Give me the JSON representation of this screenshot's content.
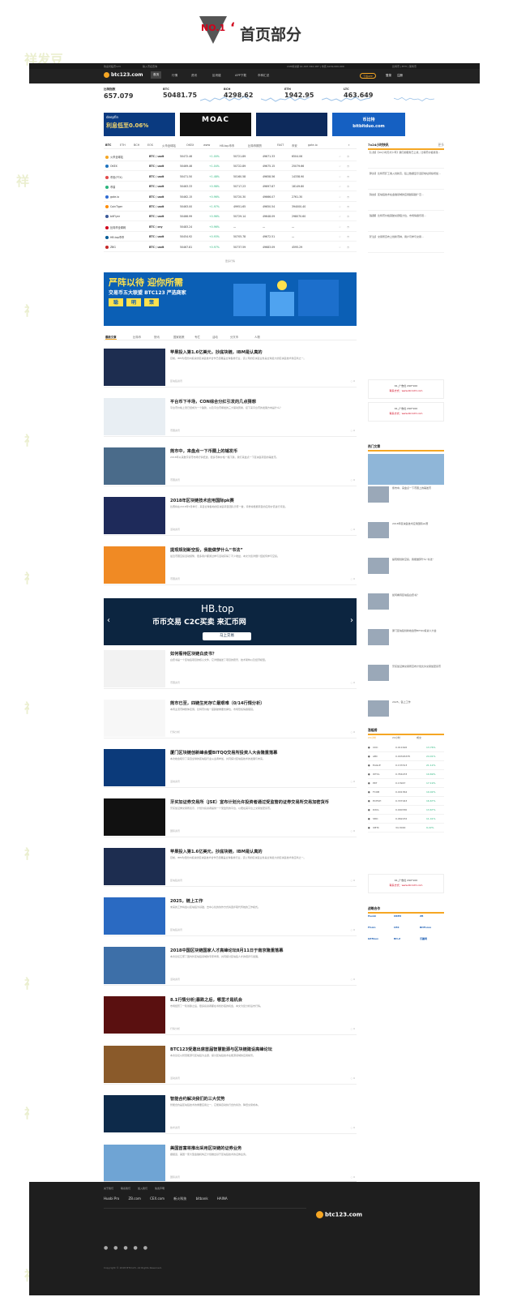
{
  "section_header": {
    "number": "NO.1",
    "title": "首页部分"
  },
  "watermark": "祥发豆",
  "topbar": {
    "left1": "欢迎光临币123",
    "left2": "输入币名查询",
    "mid": "24H成交额 $1,007,342,187 | 市值 $219,000,000",
    "right": "比特币 | ETH | 莱特币"
  },
  "nav": {
    "logo": "btc123.com",
    "items": [
      "首页",
      "行情",
      "资讯",
      "区块链",
      "APP下载",
      "币种汇总"
    ],
    "cta": "下载APP",
    "login": "登录",
    "register": "注册"
  },
  "tickers": [
    {
      "name": "比特指数",
      "price": "657.079"
    },
    {
      "name": "BTC",
      "price": "50481.75"
    },
    {
      "name": "BCH",
      "price": "4298.62"
    },
    {
      "name": "ETH",
      "price": "1942.95"
    },
    {
      "name": "LTC",
      "price": "463.649"
    }
  ],
  "banners": [
    {
      "title": "deepfin",
      "text": "利息低至0.06%"
    },
    {
      "title": "MOAC",
      "text": ""
    },
    {
      "title": "",
      "text": ""
    },
    {
      "title": "币比特",
      "text": "bitbitduo.com"
    }
  ],
  "market_tabs": [
    "BTC",
    "ETH",
    "BCH",
    "EOS",
    "火币全球站",
    "OKEX",
    "www",
    "HB.top币币",
    "比特币期货",
    "FAST",
    "币安",
    "gate.io"
  ],
  "exchanges": [
    {
      "name": "火币全球站",
      "pair": "BTC / usdt",
      "price": "50472.46",
      "change": "+1.00%",
      "high": "50721.89",
      "low": "49671.33",
      "vol": "6504.06"
    },
    {
      "name": "OKEX",
      "pair": "BTC / usdt",
      "price": "50469.46",
      "change": "+1.04%",
      "high": "50722.89",
      "low": "49675.15",
      "vol": "25079.66"
    },
    {
      "name": "币安(FTX)",
      "pair": "BTC / usdt",
      "price": "50471.50",
      "change": "+1.48%",
      "high": "50160.58",
      "low": "49658.56",
      "vol": "14338.90"
    },
    {
      "name": "币易",
      "pair": "BTC / usdt",
      "price": "50463.33",
      "change": "+0.98%",
      "high": "50717.23",
      "low": "49697.87",
      "vol": "18149.80"
    },
    {
      "name": "gate.io",
      "pair": "BTC / usdt",
      "price": "50462.15",
      "change": "+0.96%",
      "high": "50720.30",
      "low": "49666.07",
      "vol": "2761.30"
    },
    {
      "name": "CoinTiger",
      "pair": "BTC / usdt",
      "price": "50463.00",
      "change": "+1.97%",
      "high": "49951.65",
      "low": "49650.54",
      "vol": "394000.40"
    },
    {
      "name": "bitFlyer",
      "pair": "BTC / usdt",
      "price": "50466.99",
      "change": "+0.96%",
      "high": "50729.14",
      "low": "49648.09",
      "vol": "298070.60"
    },
    {
      "name": "比特币全球网",
      "pair": "BTC / cny",
      "price": "50483.24",
      "change": "+0.96%",
      "high": "—",
      "low": "—",
      "vol": "—"
    },
    {
      "name": "HB.top币币",
      "pair": "BTC / usdt",
      "price": "50454.92",
      "change": "+0.93%",
      "high": "50705.78",
      "low": "49672.51",
      "vol": "—"
    },
    {
      "name": "ZBG",
      "pair": "BTC / usdt",
      "price": "50467.81",
      "change": "+0.97%",
      "high": "50737.59",
      "low": "49683.09",
      "vol": "4595.29"
    }
  ],
  "more": "更多行情",
  "big_ad": {
    "line1": "严阵以待 迎你所需",
    "line2": "交易币五大联盟 BTC123 严选商家",
    "buttons": [
      "聪",
      "明",
      "策"
    ]
  },
  "feed_tabs": [
    "最新文章",
    "比特币",
    "快讯",
    "国家政策",
    "专栏",
    "活动",
    "分叉币",
    "人物"
  ],
  "feed": [
    {
      "title": "苹果投入第1.6亿美元，抄底块链，IBM是认真的",
      "desc": "目前，IBM为纽约州投资的区块链技术合作已经覆盖全球各类行业，该公司的区块链业务是全球最大的区块链技术供应商之一。",
      "time": "区块链资讯",
      "count": "0"
    },
    {
      "title": "平台币下半场，CON综合分红引发的几点猜想",
      "desc": "平台币价格上涨已经成为一个趋势，以及平台币爆发的三大驱动因素，接下来平台币的发展方向是什么？",
      "time": "币圈资讯",
      "count": "0"
    },
    {
      "title": "熊市中，来盘点一下币圈上的辅发币",
      "desc": "2018年以来数字货币市场行情低迷，很多币种价格一路下跌，我们来盘点一下区块链项目的辅发币。",
      "time": "币圈资讯",
      "count": "0"
    },
    {
      "title": "2018年区块链技术应用国际pk赛",
      "desc": "比赛将在2018年5月举行，来自全球各地的区块链项目团队齐聚一堂，评委将根据项目的应用价值进行评选。",
      "time": "活动资讯",
      "count": "0"
    },
    {
      "title": "提现规划新空投，我能做梦什么“书法”",
      "desc": "最近币圈空投活动频繁，很多用户都通过参与活动获得了不少收益，本文为您详细介绍如何参与空投。",
      "time": "币圈资讯",
      "count": "0"
    },
    {
      "title": "如何看待区块链白皮书？",
      "desc": "白皮书是一个区块链项目的核心文件，它详细描述了项目的愿景、技术架构以及经济模型。",
      "time": "币圈资讯",
      "count": "0"
    },
    {
      "title": "熊市已至，四链生死存亡最艰难（0/14行情分析）",
      "desc": "本周主流币种整体走弱，比特币价格一度跌破重要支撑位，市场恐慌情绪蔓延。",
      "time": "行情分析",
      "count": "0"
    },
    {
      "title": "厦门区块链创新峰会暨BITQQ交易所投资人大会隆重落幕",
      "desc": "本次峰会吸引了来自全球的区块链行业从业者参加，共同探讨区块链技术的发展与未来。",
      "time": "活动资讯",
      "count": "0"
    },
    {
      "title": "牙买加证券交易所（JSE）宣布计划允许投资者通过受监管的证券交易所交易加密货币",
      "desc": "牙买加证券交易所表示，计划为投资者提供一个受监管的平台，以便在其平台上交易加密货币。",
      "time": "国际资讯",
      "count": "0"
    },
    {
      "title": "苹果投入第1.6亿美元，抄底块链，IBM是认真的",
      "desc": "目前，IBM为纽约州投资的区块链技术合作已经覆盖全球各类行业，该公司的区块链业务是全球最大的区块链技术供应商之一。",
      "time": "区块链资讯",
      "count": "0"
    },
    {
      "title": "2025，链上工作",
      "desc": "未来的工作将会以区块链为基础，去中心化的协作方式将逐步取代传统的工作模式。",
      "time": "区块链资讯",
      "count": "0"
    },
    {
      "title": "2018中国区块链国家人才高峰论坛8月11日于南京隆重落幕",
      "desc": "本次论坛汇聚了国内外区块链领域的专家学者，共同探讨区块链人才的培养与发展。",
      "time": "活动资讯",
      "count": "0"
    },
    {
      "title": "8.1行情分析|暴跌之后，哪里才是机会",
      "desc": "市场经历了一轮暴跌之后，很多投资者都在寻找抄底的机会，本文为您分析后市行情。",
      "time": "行情分析",
      "count": "0"
    },
    {
      "title": "BTC123受邀出席首届智慧能源与区块链建设高峰论坛",
      "desc": "本次论坛以智慧能源与区块链为主题，探讨区块链技术在能源领域的应用前景。",
      "time": "活动资讯",
      "count": "0"
    },
    {
      "title": "智能合约解决我们的三大优势",
      "desc": "智能合约是区块链技术的重要应用之一，它能够自动执行合约条款，降低交易成本。",
      "time": "技术资讯",
      "count": "0"
    },
    {
      "title": "美国首富将推出采用区块链的证券业务",
      "desc": "据报道，美国一家大型金融机构正计划推出基于区块链技术的证券业务。",
      "time": "国际资讯",
      "count": "0"
    }
  ],
  "hb_ad": {
    "brand": "HB.top",
    "slogan": "币币交易 C2C买卖 来汇币网",
    "button": "马上交易"
  },
  "load_more": "点击加载更多",
  "side": {
    "news_head": "7x24小时快讯",
    "news_more": "更多",
    "news_items": [
      "【公告】【20小时天才少年】我们的服务已上线，比特币价格暴涨...",
      "【利好】比特币矿工收入创新高，链上数据显示活跃地址持续增加...",
      "【动态】区块链技术在金融领域的应用越来越广泛...",
      "【提醒】比特币价格突破关键阻力位，市场情绪乐观...",
      "【行业】交易所宣布上线新币种，用户可参与交易..."
    ],
    "ad1_title": "K1_广告位 290*100",
    "ad1_sub": "联系方式：www.btc123.com",
    "ad2_title": "K1_广告位 290*100",
    "ad2_sub": "联系方式：www.btc123.com",
    "topic_head": "热门文章",
    "topic_items": [
      "熊市中，来盘点一下币圈上的辅发币",
      "2018年区块链技术应用国际pk赛",
      "提现规划新空投，我能做梦什么“书法”",
      "如何看待区块链白皮书？",
      "厦门区块链创新峰会暨BITQQ投资人大会",
      "牙买加证券交易所宣布计划允许交易加密货币",
      "2025，链上工作"
    ],
    "rank_head": "涨幅榜",
    "rank_tabs": [
      "24小时",
      "24小时",
      "成交"
    ],
    "rank": [
      {
        "name": "CDC",
        "price": "0.011626",
        "change": "13.76%"
      },
      {
        "name": "ABC",
        "price": "0.00326335",
        "change": "24.01%"
      },
      {
        "name": "EAGLE",
        "price": "0.133313",
        "change": "21.12%"
      },
      {
        "name": "WTXL",
        "price": "0.354233",
        "change": "19.69%"
      },
      {
        "name": "PKT",
        "price": "0.13947",
        "change": "17.19%"
      },
      {
        "name": "FCOB",
        "price": "0.001364",
        "change": "19.02%"
      },
      {
        "name": "ECHSH",
        "price": "0.337043",
        "change": "16.67%"
      },
      {
        "name": "DXCL",
        "price": "0.000330",
        "change": "13.67%"
      },
      {
        "name": "SMC",
        "price": "0.062232",
        "change": "11.41%"
      },
      {
        "name": "UBTC",
        "price": "34.3000",
        "change": "9.22%"
      }
    ],
    "ad3_title": "K1_广告位 290*100",
    "ad3_sub": "联系方式：www.btc123.com",
    "partner_head": "战略合作",
    "partners": [
      "Huobi",
      "OKEX",
      "ZB",
      "FCoin",
      "CEX",
      "BitForex",
      "bitfinex",
      "Bit-Z",
      "币赢网"
    ]
  },
  "footer": {
    "links_head": [
      "关于我们",
      "联系我们",
      "加入我们",
      "免责声明"
    ],
    "partners": [
      "Huobi Pro",
      "ZB.com",
      "CEX.com",
      "新火科技",
      "bitbank",
      "HAINA"
    ],
    "logo": "btc123.com",
    "copyright": "Copyright © 2018 BTC123. All Rights Reserved."
  },
  "colors": {
    "accent": "#f5a623",
    "up": "#2ab57d",
    "down": "#e24a4a",
    "dark": "#222222"
  }
}
